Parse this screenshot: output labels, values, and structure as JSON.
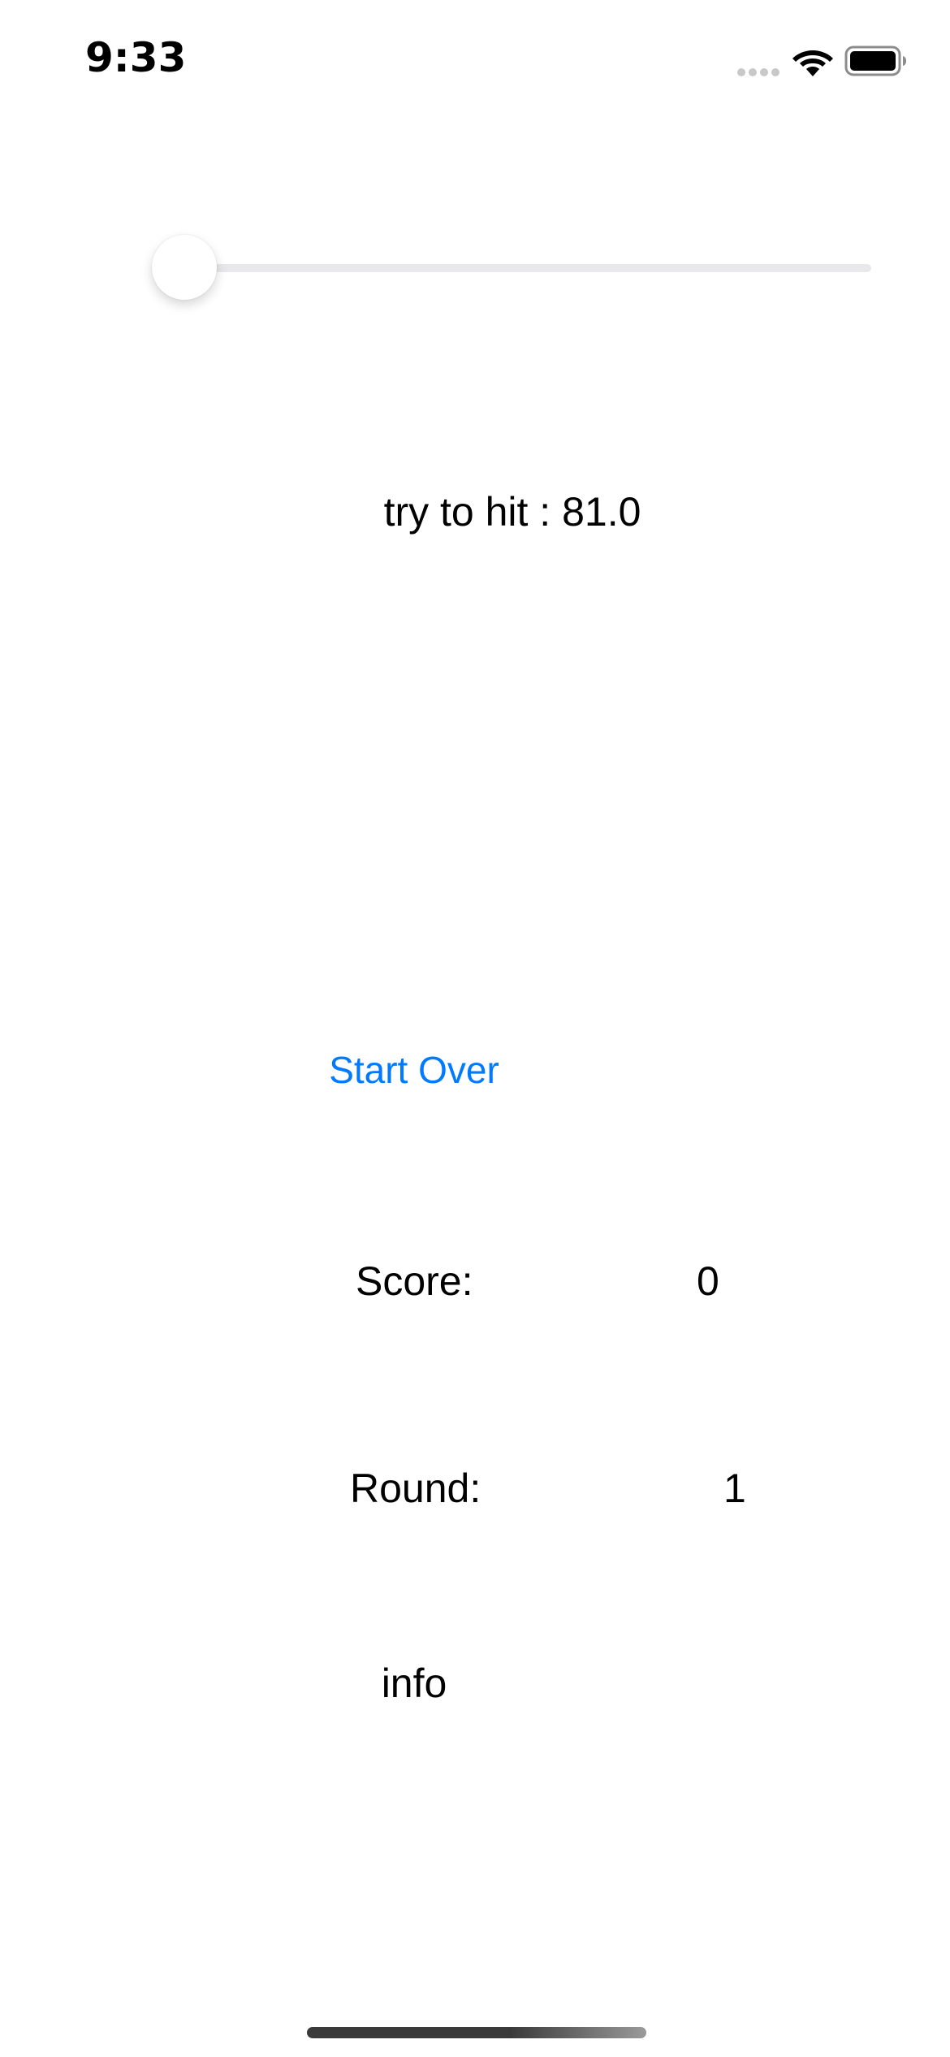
{
  "status_bar": {
    "time": "9:33",
    "icons": [
      "signal-icon",
      "wifi-icon",
      "battery-icon"
    ]
  },
  "slider": {
    "value": 0.0,
    "min": 0,
    "max": 100,
    "accent_color": "#007aff"
  },
  "target": {
    "label": "try to hit : 81.0"
  },
  "buttons": {
    "start_over": "Start Over",
    "info": "info"
  },
  "score": {
    "label": "Score:",
    "value": "0"
  },
  "round": {
    "label": "Round:",
    "value": "1"
  },
  "colors": {
    "link": "#007aff",
    "background": "#ffffff",
    "text": "#000000"
  }
}
